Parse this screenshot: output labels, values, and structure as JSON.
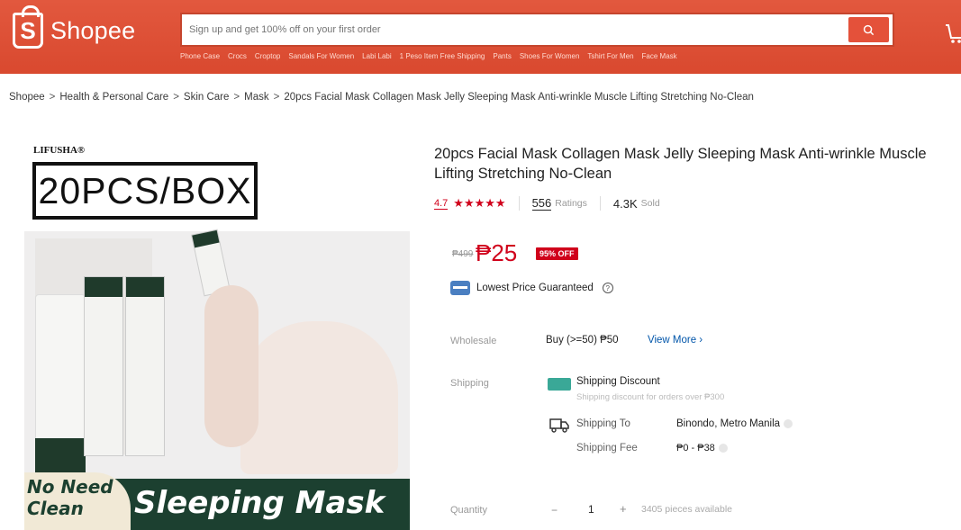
{
  "header": {
    "logo_text": "Shopee",
    "logo_glyph": "S",
    "search_placeholder": "Sign up and get 100% off on your first order",
    "suggestions": [
      "Phone Case",
      "Crocs",
      "Croptop",
      "Sandals For Women",
      "Labi Labi",
      "1 Peso Item Free Shipping",
      "Pants",
      "Shoes For Women",
      "Tshirt For Men",
      "Face Mask"
    ],
    "brand_color": "#d9492f"
  },
  "breadcrumb": {
    "items": [
      "Shopee",
      "Health & Personal Care",
      "Skin Care",
      "Mask",
      "20pcs Facial Mask Collagen Mask Jelly Sleeping Mask Anti-wrinkle Muscle Lifting Stretching No-Clean"
    ],
    "separator": ">"
  },
  "image": {
    "brand": "LIFUSHA®",
    "box_label": "20PCS/BOX",
    "badge_line1": "No Need",
    "badge_line2": "Clean",
    "banner": "Sleeping Mask"
  },
  "product": {
    "title": "20pcs Facial Mask Collagen Mask Jelly Sleeping Mask Anti-wrinkle Muscle Lifting Stretching No-Clean",
    "rating": "4.7",
    "stars": "★★★★★",
    "ratings_count": "556",
    "ratings_label": "Ratings",
    "sold_count": "4.3K",
    "sold_label": "Sold",
    "old_price": "₱499",
    "price": "₱25",
    "discount": "95% OFF",
    "guarantee": "Lowest Price Guaranteed",
    "help_glyph": "?"
  },
  "details": {
    "wholesale_label": "Wholesale",
    "wholesale_value": "Buy (>=50) ₱50",
    "view_more": "View More ›",
    "shipping_label": "Shipping",
    "shipping_discount": "Shipping Discount",
    "shipping_discount_sub": "Shipping discount for orders over ₱300",
    "ship_to_label": "Shipping To",
    "ship_to_value": "Binondo, Metro Manila",
    "ship_fee_label": "Shipping Fee",
    "ship_fee_value": "₱0 - ₱38",
    "quantity_label": "Quantity",
    "quantity_minus": "−",
    "quantity_value": "1",
    "quantity_plus": "+",
    "quantity_available": "3405 pieces available"
  }
}
